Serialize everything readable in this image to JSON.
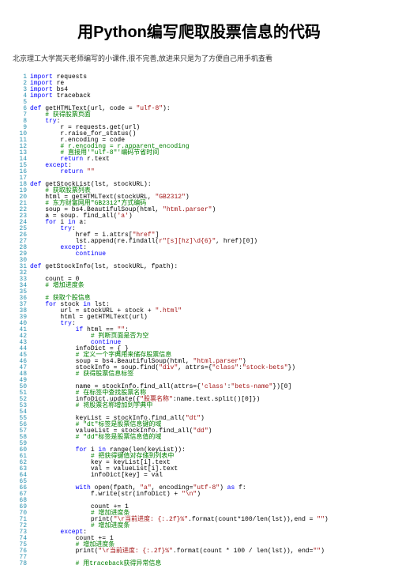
{
  "title": "用Python编写爬取股票信息的代码",
  "subtitle": "北京理工大学嵩天老师编写的小课件,很不完善,放进来只是为了方便自己用手机查看",
  "lines": [
    {
      "n": 1,
      "c": "<span class='kw'>import</span> requests"
    },
    {
      "n": 2,
      "c": "<span class='kw'>import</span> re"
    },
    {
      "n": 3,
      "c": "<span class='kw'>import</span> bs4"
    },
    {
      "n": 4,
      "c": "<span class='kw'>import</span> traceback"
    },
    {
      "n": 5,
      "c": ""
    },
    {
      "n": 6,
      "c": "<span class='kw'>def</span> getHTMLText(url, code = <span class='str'>\"ulf-8\"</span>):"
    },
    {
      "n": 7,
      "c": "    <span class='cmt'># 获得股票页面</span>"
    },
    {
      "n": 8,
      "c": "    <span class='kw'>try</span>:"
    },
    {
      "n": 9,
      "c": "        r = requests.get(url)"
    },
    {
      "n": 10,
      "c": "        r.raise_for_status()"
    },
    {
      "n": 11,
      "c": "        r.encoding = code"
    },
    {
      "n": 12,
      "c": "        <span class='cmt'># r.encoding = r.apparent_encoding</span>"
    },
    {
      "n": 13,
      "c": "        <span class='cmt'># 直接用'\"ulf-8\"'编码节省时间</span>"
    },
    {
      "n": 14,
      "c": "        <span class='kw'>return</span> r.text"
    },
    {
      "n": 15,
      "c": "    <span class='kw'>except</span>:"
    },
    {
      "n": 16,
      "c": "        <span class='kw'>return</span> <span class='str'>\"\"</span>"
    },
    {
      "n": 17,
      "c": ""
    },
    {
      "n": 18,
      "c": "<span class='kw'>def</span> getStockList(lst, stockURL):"
    },
    {
      "n": 19,
      "c": "    <span class='cmt'># 获取股票列表</span>"
    },
    {
      "n": 20,
      "c": "    html = getHTMLText(stockURL, <span class='str'>\"GB2312\"</span>)"
    },
    {
      "n": 21,
      "c": "    <span class='cmt'># 东方财富网用\"GB2312\"方式编码</span>"
    },
    {
      "n": 22,
      "c": "    soup = bs4.BeautifulSoup(html, <span class='str'>\"html.parser\"</span>)"
    },
    {
      "n": 23,
      "c": "    a = soup. find_all(<span class='str'>'a'</span>)"
    },
    {
      "n": 24,
      "c": "    <span class='kw'>for</span> i <span class='kw'>in</span> a:"
    },
    {
      "n": 25,
      "c": "        <span class='kw'>try</span>:"
    },
    {
      "n": 26,
      "c": "            href = i.attrs[<span class='str'>\"href\"</span>]"
    },
    {
      "n": 27,
      "c": "            lst.append(re.findall(<span class='str'>r\"[s][hz]\\d{6}\"</span>, href)[0])"
    },
    {
      "n": 28,
      "c": "        <span class='kw'>except</span>:"
    },
    {
      "n": 29,
      "c": "            <span class='kw'>continue</span>"
    },
    {
      "n": 30,
      "c": ""
    },
    {
      "n": 31,
      "c": "<span class='kw'>def</span> getStockInfo(lst, stockURL, fpath):"
    },
    {
      "n": 32,
      "c": ""
    },
    {
      "n": 33,
      "c": "    count = 0"
    },
    {
      "n": 34,
      "c": "    <span class='cmt'># 增加进度条</span>"
    },
    {
      "n": 35,
      "c": ""
    },
    {
      "n": 36,
      "c": "    <span class='cmt'># 获取个股信息</span>"
    },
    {
      "n": 37,
      "c": "    <span class='kw'>for</span> stock <span class='kw'>in</span> lst:"
    },
    {
      "n": 38,
      "c": "        url = stockURL + stock + <span class='str'>\".html\"</span>"
    },
    {
      "n": 39,
      "c": "        html = getHTMLText(url)"
    },
    {
      "n": 40,
      "c": "        <span class='kw'>try</span>:"
    },
    {
      "n": 41,
      "c": "            <span class='kw'>if</span> html == <span class='str'>\"\"</span>:"
    },
    {
      "n": 42,
      "c": "                <span class='cmt'># 判断页面是否为空</span>"
    },
    {
      "n": 43,
      "c": "                <span class='kw'>continue</span>"
    },
    {
      "n": 44,
      "c": "            infoDict = { }"
    },
    {
      "n": 45,
      "c": "            <span class='cmt'># 定义一个字典用来储存股票信息</span>"
    },
    {
      "n": 46,
      "c": "            soup = bs4.BeautifulSoup(html, <span class='str'>\"html.parser\"</span>)"
    },
    {
      "n": 47,
      "c": "            stockInfo = soup.find(<span class='str'>\"div\"</span>, attrs={<span class='str'>\"class\"</span>:<span class='str'>\"stock-bets\"</span>})"
    },
    {
      "n": 48,
      "c": "            <span class='cmt'># 获得股票信息标签</span>"
    },
    {
      "n": 49,
      "c": ""
    },
    {
      "n": 50,
      "c": "            name = stockInfo.find_all(attrs={<span class='str'>'class'</span>:<span class='str'>\"bets-name\"</span>})[0]"
    },
    {
      "n": 51,
      "c": "            <span class='cmt'># 在标签中查找股票名称</span>"
    },
    {
      "n": 52,
      "c": "            infoDict.update({<span class='str'>\"股票名称\"</span>:name.text.split()[0]})"
    },
    {
      "n": 53,
      "c": "            <span class='cmt'># 将股票名称增加到字典中</span>"
    },
    {
      "n": 54,
      "c": ""
    },
    {
      "n": 55,
      "c": "            keyList = stockInfo.find_all(<span class='str'>\"dt\"</span>)"
    },
    {
      "n": 56,
      "c": "            <span class='cmt'># \"dt\"标签是股票信息键的域</span>"
    },
    {
      "n": 57,
      "c": "            valueList = stockInfo.find_all(<span class='str'>\"dd\"</span>)"
    },
    {
      "n": 58,
      "c": "            <span class='cmt'># \"dd\"标签是股票信息值的域</span>"
    },
    {
      "n": 59,
      "c": ""
    },
    {
      "n": 60,
      "c": "            <span class='kw'>for</span> i <span class='kw'>in</span> range(len(keyList)):"
    },
    {
      "n": 61,
      "c": "                <span class='cmt'># 把获得键值对存储到列表中</span>"
    },
    {
      "n": 62,
      "c": "                key = keyList[i].text"
    },
    {
      "n": 63,
      "c": "                val = valueList[i].text"
    },
    {
      "n": 64,
      "c": "                infoDict[key] = val"
    },
    {
      "n": 65,
      "c": ""
    },
    {
      "n": 66,
      "c": "            <span class='kw'>with</span> open(fpath, <span class='str'>\"a\"</span>, encoding=<span class='str'>\"utf-8\"</span>) <span class='kw'>as</span> f:"
    },
    {
      "n": 67,
      "c": "                f.write(str(infoDict) + <span class='str'>\"\\n\"</span>)"
    },
    {
      "n": 68,
      "c": ""
    },
    {
      "n": 69,
      "c": "                count += 1"
    },
    {
      "n": 70,
      "c": "                <span class='cmt'># 增加进度条</span>"
    },
    {
      "n": 71,
      "c": "                print(<span class='str'>\"\\r当前进度: {:.2f}%\"</span>.format(count*100/len(lst)),end = <span class='str'>\"\"</span>)"
    },
    {
      "n": 72,
      "c": "                <span class='cmt'># 增加进度条</span>"
    },
    {
      "n": 73,
      "c": "        <span class='kw'>except</span>:"
    },
    {
      "n": 74,
      "c": "            count += 1"
    },
    {
      "n": 75,
      "c": "            <span class='cmt'># 增加进度条</span>"
    },
    {
      "n": 76,
      "c": "            print(<span class='str'>\"\\r当前进度: {:.2f}%\"</span>.format(count * 100 / len(lst)), end=<span class='str'>\"\"</span>)"
    },
    {
      "n": 77,
      "c": ""
    },
    {
      "n": 78,
      "c": "            <span class='cmt'># 用traceback获得异常信息</span>"
    }
  ]
}
